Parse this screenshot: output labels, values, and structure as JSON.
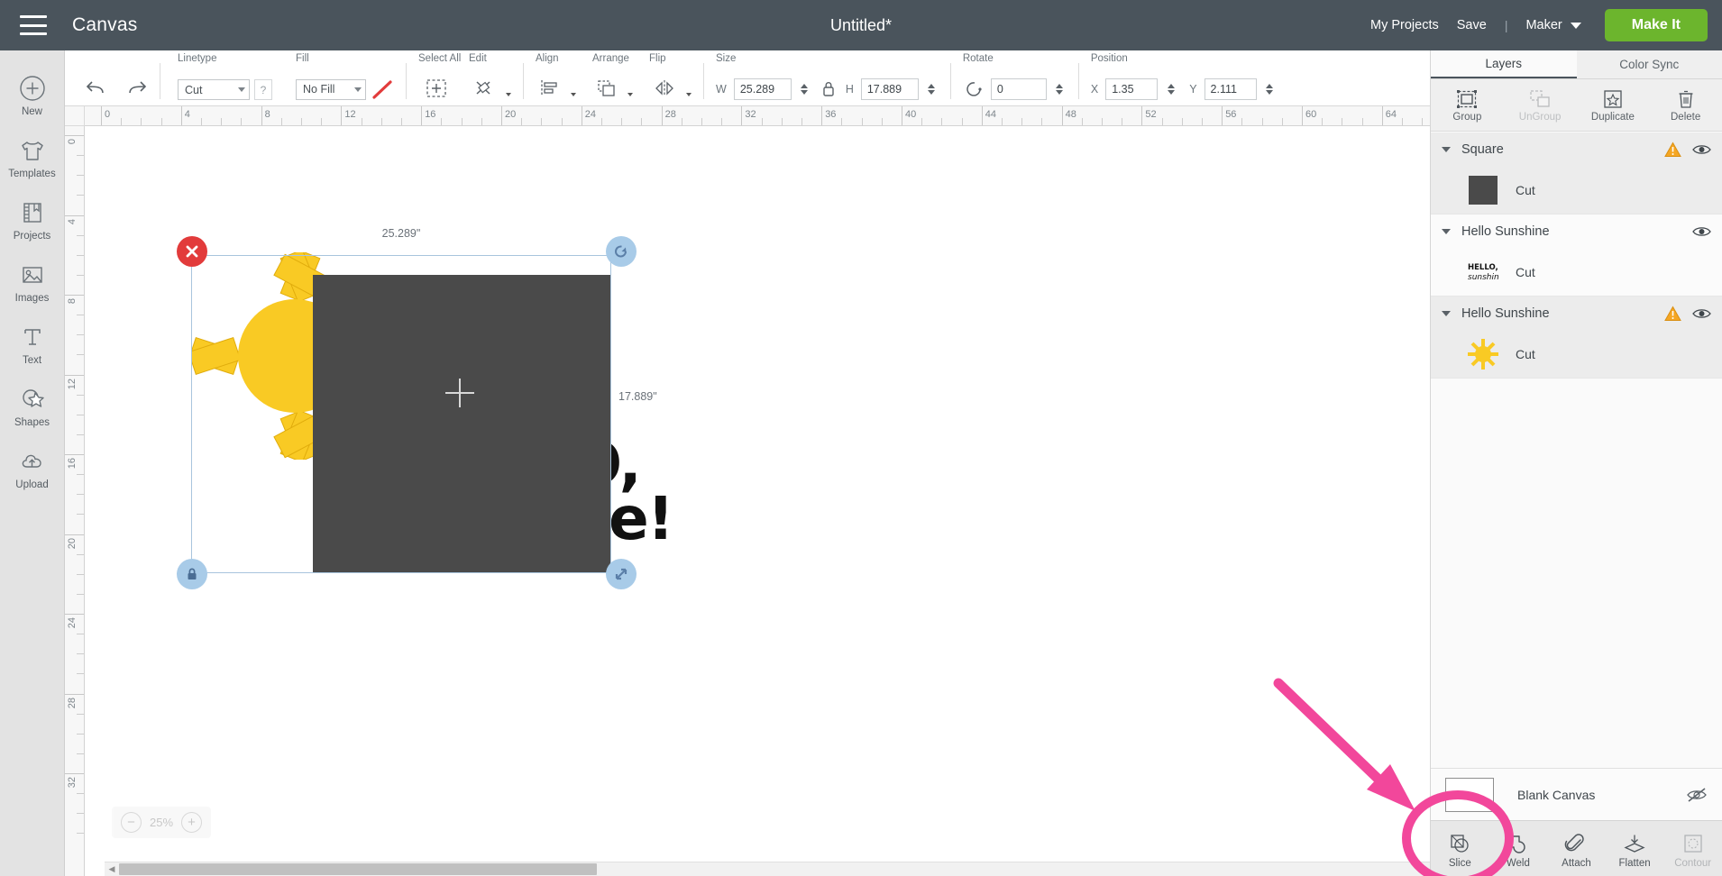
{
  "header": {
    "menu_icon": "hamburger-menu-icon",
    "canvas_label": "Canvas",
    "project_title": "Untitled*",
    "my_projects": "My Projects",
    "save": "Save",
    "separator": "|",
    "machine": "Maker",
    "make_it": "Make It",
    "make_it_color": "#6cb52d",
    "bar_color": "#4a545c"
  },
  "sidebar": {
    "items": [
      {
        "label": "New",
        "icon": "plus-circle-icon"
      },
      {
        "label": "Templates",
        "icon": "tshirt-icon"
      },
      {
        "label": "Projects",
        "icon": "book-bookmark-icon"
      },
      {
        "label": "Images",
        "icon": "picture-icon"
      },
      {
        "label": "Text",
        "icon": "text-t-icon"
      },
      {
        "label": "Shapes",
        "icon": "shapes-star-icon"
      },
      {
        "label": "Upload",
        "icon": "cloud-upload-icon"
      }
    ]
  },
  "toolbar": {
    "undo": "undo-arrow-icon",
    "redo": "redo-arrow-icon",
    "linetype": {
      "title": "Linetype",
      "value": "Cut",
      "help": "?"
    },
    "fill": {
      "title": "Fill",
      "value": "No Fill",
      "swatch": "no-fill-diagonal-icon"
    },
    "select_all": {
      "title": "Select All",
      "icon": "select-all-icon"
    },
    "edit": {
      "title": "Edit",
      "icon": "edit-scissors-icon"
    },
    "align": {
      "title": "Align",
      "icon": "align-icon"
    },
    "arrange": {
      "title": "Arrange",
      "icon": "arrange-layers-icon"
    },
    "flip": {
      "title": "Flip",
      "icon": "flip-icon"
    },
    "size": {
      "title": "Size",
      "lock_icon": "lock-closed-icon",
      "w_label": "W",
      "w_value": "25.289",
      "h_label": "H",
      "h_value": "17.889"
    },
    "rotate": {
      "title": "Rotate",
      "icon": "rotate-icon",
      "value": "0"
    },
    "position": {
      "title": "Position",
      "x_label": "X",
      "x_value": "1.35",
      "y_label": "Y",
      "y_value": "2.111"
    }
  },
  "canvas": {
    "ruler_h_ticks": [
      "0",
      "4",
      "8",
      "12",
      "16",
      "20",
      "24",
      "28",
      "32",
      "36",
      "40",
      "44",
      "48",
      "52",
      "56",
      "60",
      "64"
    ],
    "ruler_v_ticks": [
      "0",
      "4",
      "8",
      "12",
      "16",
      "20",
      "24",
      "28",
      "32"
    ],
    "dim_width": "25.289\"",
    "dim_height": "17.889\"",
    "zoom_level": "25%",
    "zoom_out": "−",
    "zoom_in": "+",
    "handles": {
      "delete": "delete-x-handle-icon",
      "rotate": "rotate-handle-icon",
      "lock": "lock-handle-icon",
      "resize": "resize-handle-icon"
    },
    "crosshair": "crosshair-icon",
    "artwork": {
      "sun_color": "#f9ca24",
      "square_color": "#4a4a4a",
      "text_line1": "O,",
      "text_line2": "ve!"
    },
    "scroll_left_arrow": "◀",
    "scroll_right_arrow": "▶"
  },
  "right_panel": {
    "tabs": [
      {
        "label": "Layers",
        "active": true
      },
      {
        "label": "Color Sync",
        "active": false
      }
    ],
    "actions": [
      {
        "label": "Group",
        "icon": "group-icon",
        "disabled": false
      },
      {
        "label": "UnGroup",
        "icon": "ungroup-icon",
        "disabled": true
      },
      {
        "label": "Duplicate",
        "icon": "duplicate-icon",
        "disabled": false
      },
      {
        "label": "Delete",
        "icon": "trash-icon",
        "disabled": false
      }
    ],
    "layers": [
      {
        "name": "Square",
        "has_warning": true,
        "visible": true,
        "child_label": "Cut",
        "thumb": "dark-square-thumb",
        "thumb_color": "#4a4a4a",
        "shaded": true
      },
      {
        "name": "Hello Sunshine",
        "has_warning": false,
        "visible": true,
        "child_label": "Cut",
        "thumb": "hello-sunshine-text-thumb",
        "thumb_color": "#111111",
        "shaded": false
      },
      {
        "name": "Hello Sunshine",
        "has_warning": true,
        "visible": true,
        "child_label": "Cut",
        "thumb": "sun-burst-thumb",
        "thumb_color": "#f9ca24",
        "shaded": true
      }
    ],
    "canvas_row": {
      "label": "Blank Canvas",
      "icon": "eye-hidden-icon"
    },
    "operations": [
      {
        "label": "Slice",
        "icon": "slice-icon",
        "disabled": false,
        "highlighted": true
      },
      {
        "label": "Weld",
        "icon": "weld-icon",
        "disabled": false,
        "highlighted": false
      },
      {
        "label": "Attach",
        "icon": "paperclip-icon",
        "disabled": false,
        "highlighted": false
      },
      {
        "label": "Flatten",
        "icon": "flatten-icon",
        "disabled": false,
        "highlighted": false
      },
      {
        "label": "Contour",
        "icon": "contour-icon",
        "disabled": true,
        "highlighted": false
      }
    ]
  },
  "annotation": {
    "color": "#f2479b",
    "arrow": "pink-arrow-annotation",
    "circle": "pink-circle-annotation"
  }
}
